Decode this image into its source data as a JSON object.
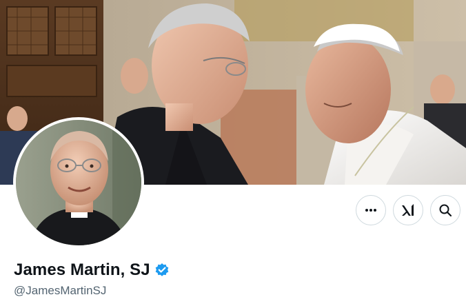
{
  "profile": {
    "display_name": "James Martin, SJ",
    "handle": "@JamesMartinSJ",
    "verified": true
  },
  "actions": [
    {
      "name": "more",
      "icon": "more-dots-icon"
    },
    {
      "name": "grok",
      "icon": "grok-icon"
    },
    {
      "name": "search",
      "icon": "search-icon"
    }
  ],
  "colors": {
    "verified_badge": "#1d9bf0",
    "text_primary": "#0f1419",
    "text_secondary": "#536471",
    "button_border": "#cfd9de"
  }
}
